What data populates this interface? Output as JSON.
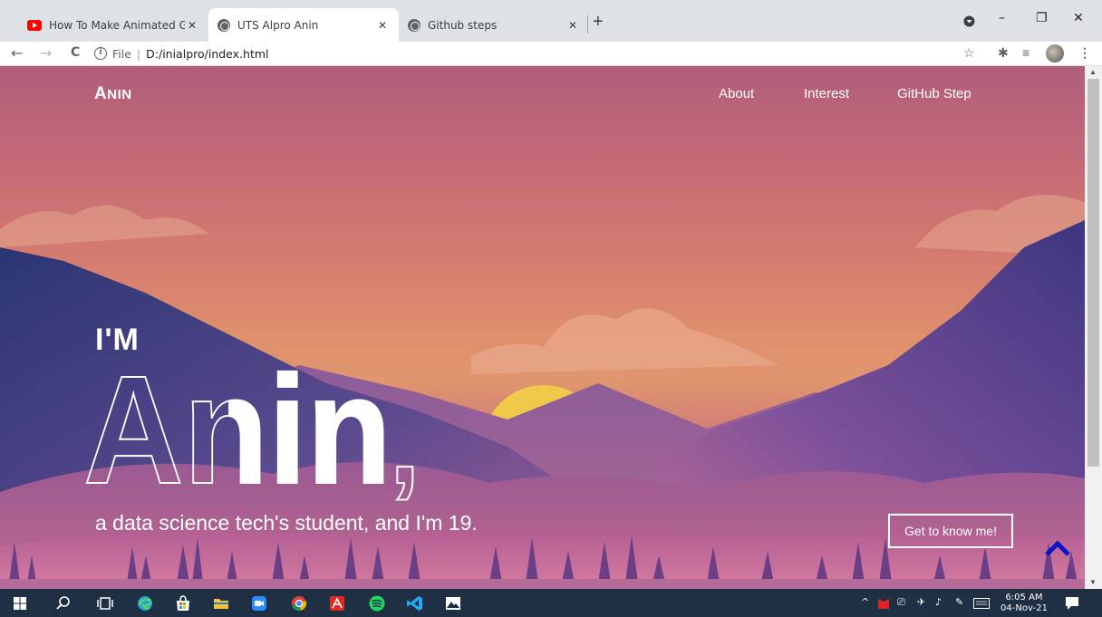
{
  "browser": {
    "tabs": [
      {
        "title": "How To Make Animated Gradient",
        "close": "✕"
      },
      {
        "title": "UTS Alpro Anin",
        "close": "✕"
      },
      {
        "title": "Github steps",
        "close": "✕"
      }
    ],
    "new_tab": "+",
    "window_controls": {
      "minimize": "–",
      "restore": "❐",
      "close": "✕"
    },
    "address": {
      "info": "i",
      "scheme": "File",
      "divider": "|",
      "path": "D:/inialpro/index.html"
    },
    "nav": {
      "back": "←",
      "forward": "→",
      "reload": "C"
    },
    "toolbar_icons": {
      "star": "☆",
      "extensions": "✱",
      "reading_list": "≡",
      "menu": "⋮"
    }
  },
  "site": {
    "logo": {
      "first": "A",
      "rest": "NIN"
    },
    "nav_links": [
      "About",
      "Interest",
      "GitHub Step"
    ],
    "hero": {
      "intro": "I'M",
      "name": "Anin",
      "comma": ",",
      "subtitle": "a data science tech's student, and I'm 19."
    },
    "cta_label": "Get to know me!",
    "back_to_top": "back-to-top"
  },
  "taskbar": {
    "clock_time": "6:05 AM",
    "clock_date": "04-Nov-21",
    "apps": [
      "windows-start",
      "search",
      "task-view",
      "edge",
      "store",
      "file-explorer",
      "zoom",
      "chrome",
      "acrobat",
      "spotify",
      "vscode",
      "photos"
    ]
  },
  "colors": {
    "tabstrip": "#dee1e6",
    "sun": "#f0c84a",
    "mountain_dark": "#3a3a7a",
    "mountain_mid": "#7a4b8f",
    "taskbar": "#1f2f44",
    "accent_blue": "#0a14c8"
  }
}
